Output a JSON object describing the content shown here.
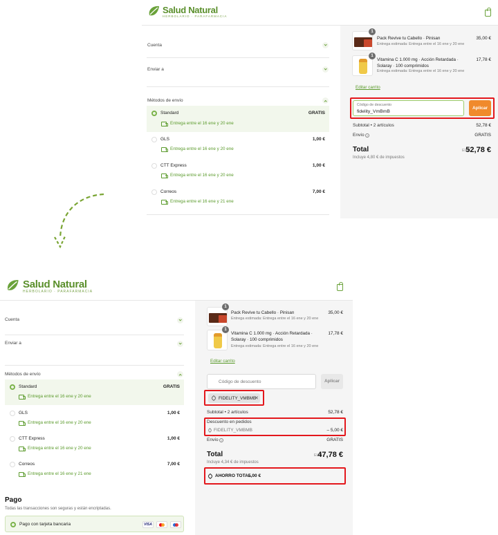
{
  "brand": {
    "name": "Salud Natural",
    "tagline": "HERBOLARIO · PARAFARMACIA",
    "accent": "#6aa23a",
    "highlight": "#e3161b",
    "apply_orange": "#f08a2c"
  },
  "sections": {
    "account": "Cuenta",
    "ship_to": "Enviar a",
    "shipping_methods": "Métodos de envío"
  },
  "shipping_options": [
    {
      "name": "Standard",
      "price": "GRATIS",
      "eta": "Entrega entre el 16 ene y 20 ene",
      "selected": true
    },
    {
      "name": "GLS",
      "price": "1,00 €",
      "eta": "Entrega entre el 16 ene y 20 ene",
      "selected": false
    },
    {
      "name": "CTT Express",
      "price": "1,00 €",
      "eta": "Entrega entre el 16 ene y 20 ene",
      "selected": false
    },
    {
      "name": "Correos",
      "price": "7,00 €",
      "eta": "Entrega entre el 16 ene y 21 ene",
      "selected": false
    }
  ],
  "items": [
    {
      "qty": "1",
      "name": "Pack Revive tu Cabello · Pinisan",
      "delivery": "Entrega estimada: Entrega entre el 16 ene y 20 ene",
      "price": "35,00 €"
    },
    {
      "qty": "1",
      "name_line1": "Vitamina C 1.000 mg · Acción Retardada ·",
      "name_line2": "Solaray · 100 comprimidos",
      "delivery": "Entrega estimada: Entrega entre el 16 ene y 20 ene",
      "price": "17,78 €"
    }
  ],
  "edit_cart": "Editar carrito",
  "before": {
    "discount_label": "Código de descuento",
    "discount_value": "fidelity_VmBmB",
    "apply": "Aplicar",
    "subtotal_label": "Subtotal • 2 artículos",
    "subtotal": "52,78 €",
    "shipping_label": "Envío",
    "shipping": "GRATIS",
    "total_label": "Total",
    "currency": "EUR",
    "total": "52,78 €",
    "tax_note": "Incluye 4,80 € de impuestos"
  },
  "after": {
    "discount_placeholder": "Código de descuento",
    "apply": "Aplicar",
    "applied_code": "FIDELITY_VMBMB",
    "subtotal_label": "Subtotal • 2 artículos",
    "subtotal": "52,78 €",
    "order_discount_label": "Descuento en pedidos",
    "order_discount_code": "FIDELITY_VMBMB",
    "order_discount": "– 5,00 €",
    "shipping_label": "Envío",
    "shipping": "GRATIS",
    "total_label": "Total",
    "currency": "EUR",
    "total": "47,78 €",
    "tax_note": "Incluye 4,34 € de impuestos",
    "savings_label": "AHORRO TOTAL",
    "savings": "5,00 €"
  },
  "payment": {
    "title": "Pago",
    "note": "Todas las transacciones son seguras y están encriptadas.",
    "method": "Pago con tarjeta bancaria",
    "card_visa": "VISA"
  }
}
